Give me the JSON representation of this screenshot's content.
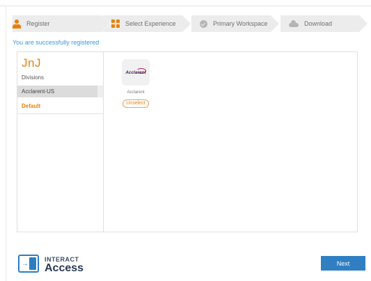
{
  "stepper": {
    "steps": [
      {
        "label": "Register",
        "icon": "user-icon",
        "state": "active"
      },
      {
        "label": "Select Experience",
        "icon": "grid-icon",
        "state": "active"
      },
      {
        "label": "Primary Workspace",
        "icon": "check-circle-icon",
        "state": "pending"
      },
      {
        "label": "Download",
        "icon": "cloud-icon",
        "state": "pending"
      }
    ]
  },
  "success_message": "You are successfully registered",
  "sidebar": {
    "company": "JnJ",
    "divisions_label": "Divisions",
    "division_selected": "Acclarent-US",
    "default_label": "Default"
  },
  "experience": {
    "tile_logo_text": "Acclarent",
    "tile_name": "Acclarent",
    "unselect_label": "Unselect"
  },
  "footer": {
    "brand_top": "INTERACT",
    "brand_bottom": "Access",
    "next_label": "Next"
  },
  "colors": {
    "accent_orange": "#e8810c",
    "primary_blue": "#2f7fc2",
    "success_blue": "#3a9ad9"
  }
}
